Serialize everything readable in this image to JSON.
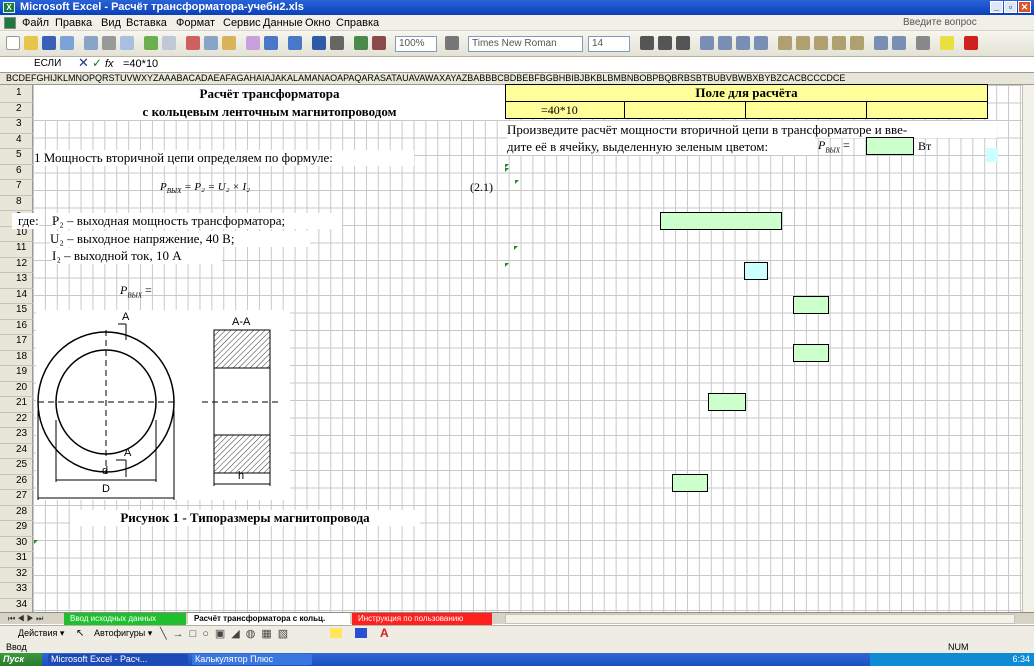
{
  "window": {
    "title": "Microsoft Excel - Расчёт трансформатора-учебн2.xls",
    "min": "_",
    "max": "▫",
    "close": "✕"
  },
  "menu": {
    "items": [
      "Файл",
      "Правка",
      "Вид",
      "Вставка",
      "Формат",
      "Сервис",
      "Данные",
      "Окно",
      "Справка"
    ],
    "ask_placeholder": "Введите вопрос"
  },
  "toolbar": {
    "zoom": "100%",
    "font": "Times New Roman",
    "size": "14"
  },
  "formula_bar": {
    "name_box": "ЕСЛИ",
    "fx": "fx",
    "formula": "=40*10"
  },
  "column_header": "BCDEFGHIJKLMNOPQRSTUVWXYZAAABACADAEAFAGAHAIAJAKALAMANAOAPAQARASATAUAVAWAXAYAZBABBBCBDBEBFBGBHBIBJBKBLBMBNBOBPBQBRBSBTBUBVBWBXBYBZCACBCCCDCE",
  "rows": [
    "1",
    "2",
    "3",
    "4",
    "5",
    "6",
    "7",
    "8",
    "9",
    "10",
    "11",
    "12",
    "13",
    "14",
    "15",
    "16",
    "17",
    "18",
    "19",
    "20",
    "21",
    "22",
    "23",
    "24",
    "25",
    "26",
    "27",
    "28",
    "29",
    "30",
    "31",
    "32",
    "33",
    "34"
  ],
  "sheet": {
    "title1": "Расчёт трансформатора",
    "title2": "с кольцевым ленточным магнитопроводом",
    "calc_header": "Поле для расчёта",
    "calc_cell": "=40*10",
    "instruction1": "Произведите расчёт мощности вторичной цепи в трансформаторе и вве-",
    "instruction2": "дите её в ячейку, выделенную зеленым цветом:",
    "pvyx_label": "P",
    "pvyx_sub": "ВЫХ",
    "eq": " =",
    "unit": "Вт",
    "step1": "1 Мощность вторичной цепи определяем по формуле:",
    "formula_main": "P",
    "formula_sub": "ВЫХ",
    "formula_rest": " = P₂ = U₂ × I₂",
    "formula_num": "(2.1)",
    "where": "где:",
    "p2": "P₂ – выходная мощность трансформатора;",
    "u2": "U₂ – выходное напряжение, 40 В;",
    "i2": "I₂ – выходной ток, 10 А",
    "pvyx_eq_main": "P",
    "pvyx_eq_sub": "ВЫХ",
    "pvyx_eq_rest": " =",
    "fig_caption": "Рисунок 1 - Типоразмеры магнитопровода",
    "fig_labels": {
      "A_top": "A",
      "AA": "A-A",
      "A_bottom": "A",
      "d": "d",
      "D": "D",
      "h": "h"
    }
  },
  "sheet_tabs": [
    {
      "label": "Ввод исходных данных",
      "color": "#1fbf2f"
    },
    {
      "label": "Расчёт трансформатора с кольц.",
      "color": "#ffffff"
    },
    {
      "label": "Инструкция по пользованию",
      "color": "#ff2020"
    }
  ],
  "drawing_toolbar": {
    "actions": "Действия ▾",
    "autoshapes": "Автофигуры ▾"
  },
  "status": {
    "mode": "Ввод",
    "num": "NUM"
  },
  "taskbar": {
    "start": "Пуск",
    "tasks": [
      "Microsoft Excel - Расч...",
      "Калькулятор Плюс"
    ],
    "time": "6:34"
  }
}
